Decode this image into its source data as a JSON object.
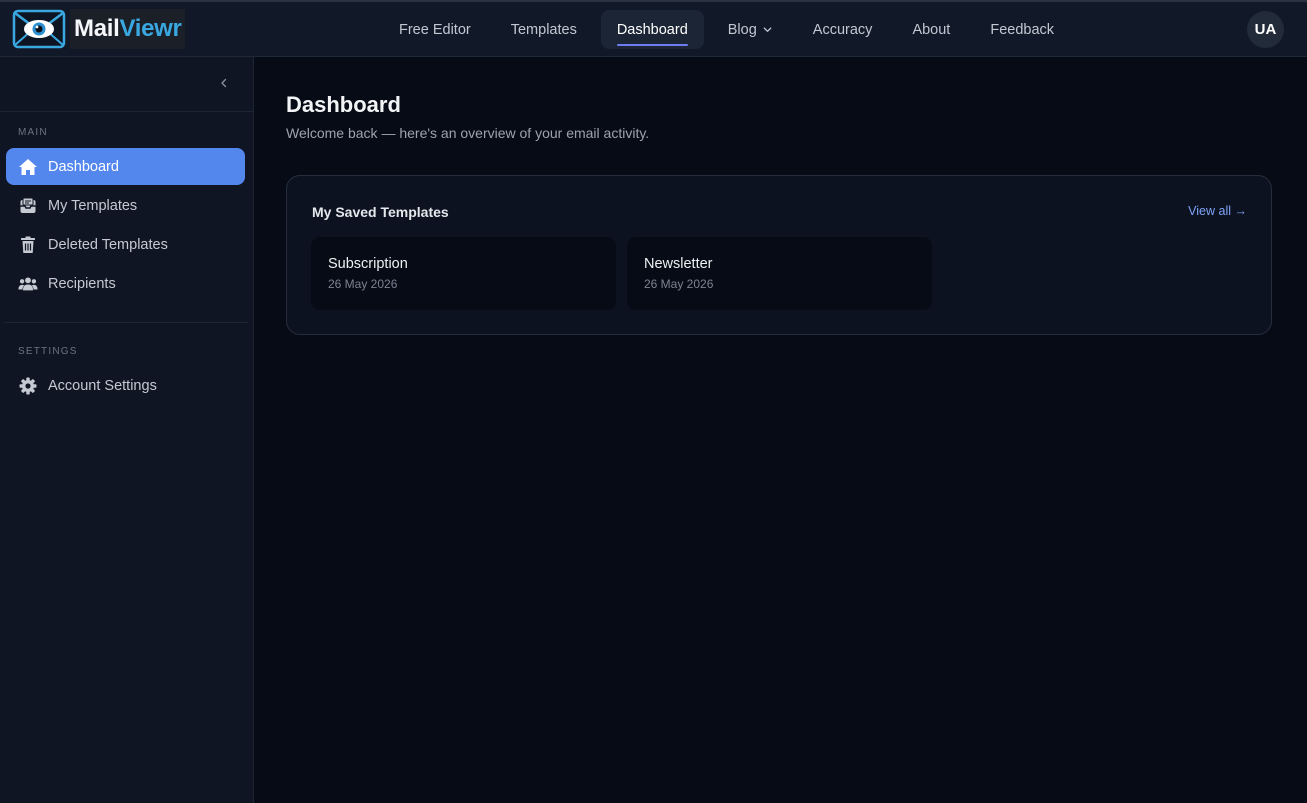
{
  "brand": {
    "name_part1": "Mail",
    "name_part2": "Viewr"
  },
  "nav": {
    "items": [
      {
        "label": "Free Editor"
      },
      {
        "label": "Templates"
      },
      {
        "label": "Dashboard",
        "active": true
      },
      {
        "label": "Blog",
        "dropdown": true
      },
      {
        "label": "Accuracy"
      },
      {
        "label": "About"
      },
      {
        "label": "Feedback"
      }
    ]
  },
  "user": {
    "initials": "UA"
  },
  "sidebar": {
    "main_heading": "MAIN",
    "items": [
      {
        "label": "Dashboard",
        "icon": "home-icon",
        "active": true
      },
      {
        "label": "My Templates",
        "icon": "template-inbox-icon"
      },
      {
        "label": "Deleted Templates",
        "icon": "trash-icon"
      },
      {
        "label": "Recipients",
        "icon": "users-icon"
      }
    ],
    "settings_heading": "SETTINGS",
    "settings_items": [
      {
        "label": "Account Settings",
        "icon": "gear-icon"
      }
    ]
  },
  "page": {
    "title": "Dashboard",
    "subtitle": "Welcome back — here's an overview of your email activity."
  },
  "saved_templates": {
    "title": "My Saved Templates",
    "view_all_label": "View all →",
    "items": [
      {
        "name": "Subscription",
        "date": "26 May 2026"
      },
      {
        "name": "Newsletter",
        "date": "26 May 2026"
      }
    ]
  },
  "colors": {
    "accent": "#5387ee",
    "brand_blue": "#3aa8e0",
    "link": "#7ea3f7",
    "background": "#070b16",
    "surface": "#0f1523"
  }
}
